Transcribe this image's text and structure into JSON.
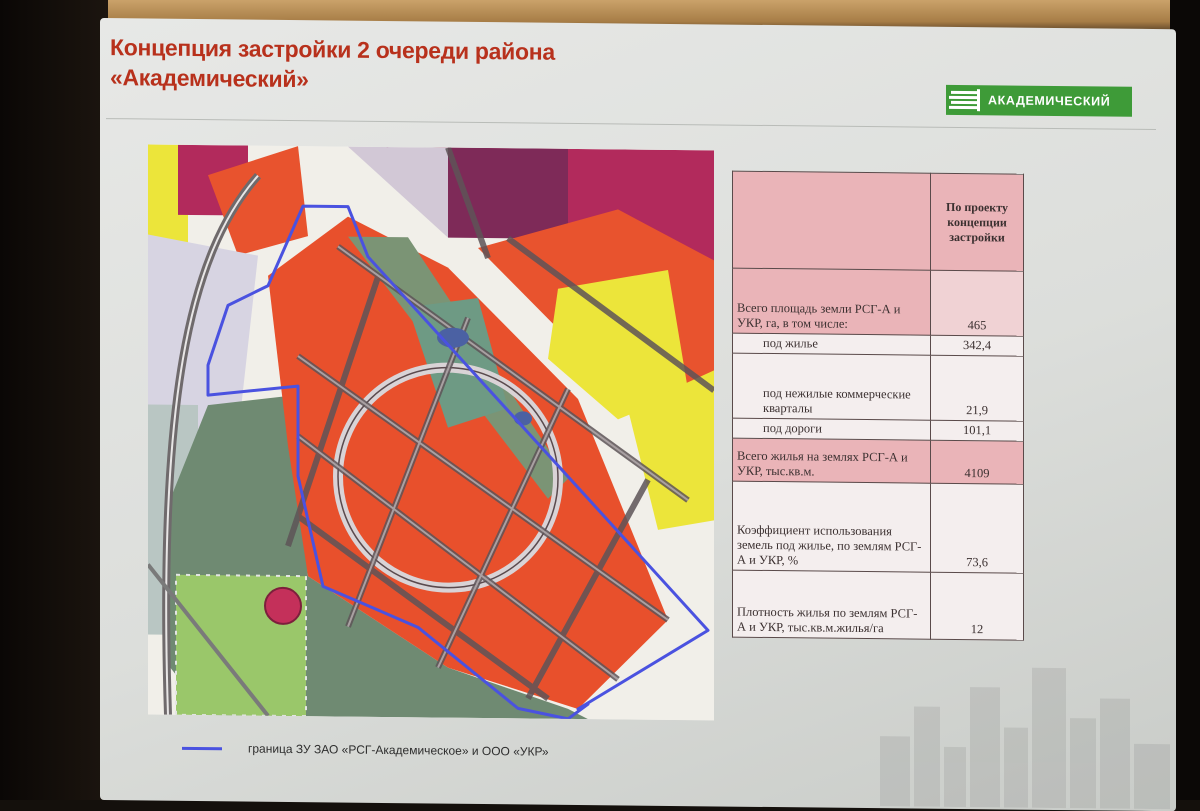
{
  "slide": {
    "title_line1": "Концепция застройки 2 очереди района",
    "title_line2": "«Академический»",
    "logo_text": "АКАДЕМИЧЕСКИЙ"
  },
  "table": {
    "header": "По проекту концепции застройки",
    "rows": [
      {
        "label": "Всего площадь земли РСГ-А и УКР, га, в том числе:",
        "value": "465"
      },
      {
        "label": "под жилье",
        "value": "342,4"
      },
      {
        "label": "под нежилые коммерческие кварталы",
        "value": "21,9"
      },
      {
        "label": "под дороги",
        "value": "101,1"
      },
      {
        "label": "Всего жилья на землях РСГ-А и УКР, тыс.кв.м.",
        "value": "4109"
      },
      {
        "label": "Коэффициент использования земель под жилье, по землям РСГ-А и УКР, %",
        "value": "73,6"
      },
      {
        "label": "Плотность жилья по землям РСГ-А и УКР, тыс.кв.м.жилья/га",
        "value": "12"
      }
    ]
  },
  "legend": {
    "label": "граница ЗУ ЗАО «РСГ-Академическое» и ООО «УКР»"
  },
  "colors": {
    "title": "#b8311c",
    "logo_bg": "#3e9b38",
    "boundary": "#4a52e0",
    "residential": "#e8502c",
    "commercial": "#8a1e4a",
    "park": "#6f8a72",
    "yellow_zone": "#ece53a"
  }
}
